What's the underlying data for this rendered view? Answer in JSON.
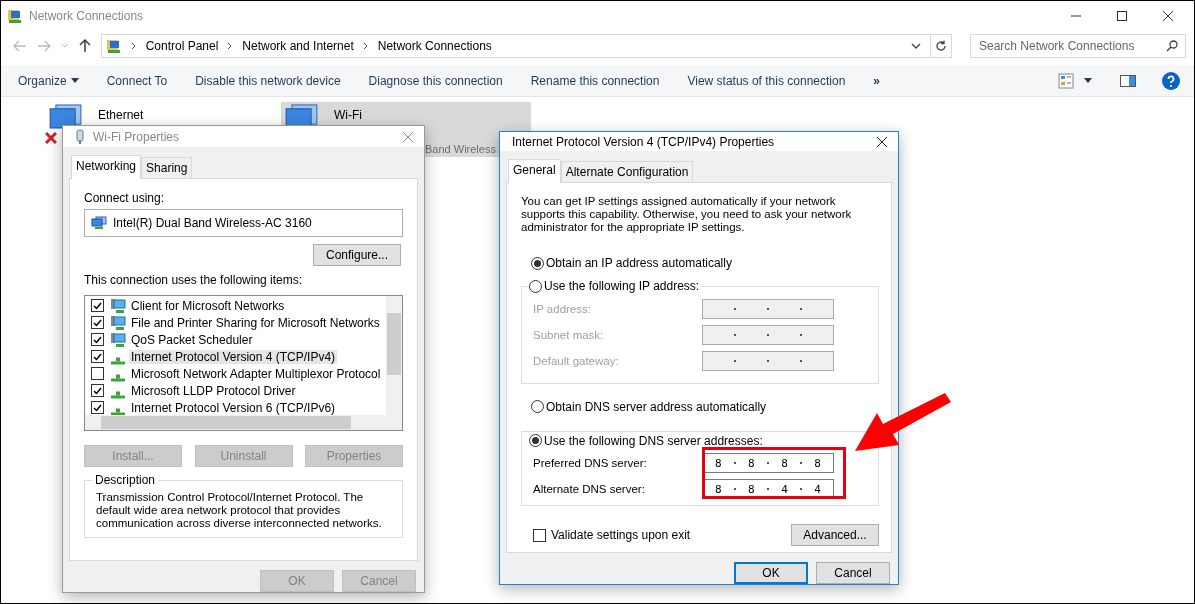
{
  "window": {
    "title": "Network Connections"
  },
  "address_bar": {
    "path": [
      "Control Panel",
      "Network and Internet",
      "Network Connections"
    ]
  },
  "search": {
    "placeholder": "Search Network Connections"
  },
  "toolbar": [
    {
      "label": "Organize",
      "kind": "menu"
    },
    {
      "label": "Connect To",
      "kind": "action"
    },
    {
      "label": "Disable this network device",
      "kind": "action"
    },
    {
      "label": "Diagnose this connection",
      "kind": "action"
    },
    {
      "label": "Rename this connection",
      "kind": "action"
    },
    {
      "label": "View status of this connection",
      "kind": "action"
    },
    {
      "label": "»",
      "kind": "more"
    }
  ],
  "connections": [
    {
      "name": "Ethernet",
      "disconnected": true,
      "selected": false
    },
    {
      "name": "Wi-Fi",
      "disconnected": false,
      "selected": true,
      "detail": "Band Wireless"
    }
  ],
  "wifi_dialog": {
    "title": "Wi-Fi Properties",
    "tabs": [
      {
        "label": "Networking",
        "selected": true
      },
      {
        "label": "Sharing",
        "selected": false
      }
    ],
    "connect_using_label": "Connect using:",
    "adapter": "Intel(R) Dual Band Wireless-AC 3160",
    "configure_button": "Configure...",
    "items_label": "This connection uses the following items:",
    "items": [
      {
        "label": "Client for Microsoft Networks",
        "checked": true,
        "selected": false,
        "kind": "service"
      },
      {
        "label": "File and Printer Sharing for Microsoft Networks",
        "checked": true,
        "selected": false,
        "kind": "service"
      },
      {
        "label": "QoS Packet Scheduler",
        "checked": true,
        "selected": false,
        "kind": "service"
      },
      {
        "label": "Internet Protocol Version 4 (TCP/IPv4)",
        "checked": true,
        "selected": true,
        "kind": "protocol"
      },
      {
        "label": "Microsoft Network Adapter Multiplexor Protocol",
        "checked": false,
        "selected": false,
        "kind": "protocol"
      },
      {
        "label": "Microsoft LLDP Protocol Driver",
        "checked": true,
        "selected": false,
        "kind": "protocol"
      },
      {
        "label": "Internet Protocol Version 6 (TCP/IPv6)",
        "checked": true,
        "selected": false,
        "kind": "protocol"
      }
    ],
    "item_buttons": [
      {
        "label": "Install...",
        "disabled": true
      },
      {
        "label": "Uninstall",
        "disabled": true
      },
      {
        "label": "Properties",
        "disabled": true
      }
    ],
    "description_title": "Description",
    "description": "Transmission Control Protocol/Internet Protocol. The default wide area network protocol that provides communication across diverse interconnected networks.",
    "footer_buttons": [
      {
        "label": "OK",
        "disabled": true
      },
      {
        "label": "Cancel",
        "disabled": true
      }
    ]
  },
  "ipv4_dialog": {
    "title": "Internet Protocol Version 4 (TCP/IPv4) Properties",
    "tabs": [
      {
        "label": "General",
        "selected": true
      },
      {
        "label": "Alternate Configuration",
        "selected": false
      }
    ],
    "intro": "You can get IP settings assigned automatically if your network supports this capability. Otherwise, you need to ask your network administrator for the appropriate IP settings.",
    "ip_options": [
      {
        "label": "Obtain an IP address automatically",
        "selected": true
      },
      {
        "label": "Use the following IP address:",
        "selected": false
      }
    ],
    "ip_fields": [
      {
        "label": "IP address:",
        "disabled": true
      },
      {
        "label": "Subnet mask:",
        "disabled": true
      },
      {
        "label": "Default gateway:",
        "disabled": true
      }
    ],
    "dns_options": [
      {
        "label": "Obtain DNS server address automatically",
        "selected": false
      },
      {
        "label": "Use the following DNS server addresses:",
        "selected": true
      }
    ],
    "dns_fields": [
      {
        "label": "Preferred DNS server:",
        "disabled": false,
        "octets": [
          "8",
          "8",
          "8",
          "8"
        ]
      },
      {
        "label": "Alternate DNS server:",
        "disabled": false,
        "octets": [
          "8",
          "8",
          "4",
          "4"
        ]
      }
    ],
    "validate": {
      "label": "Validate settings upon exit",
      "checked": false
    },
    "advanced_button": "Advanced...",
    "footer_buttons": [
      {
        "label": "OK",
        "default": true
      },
      {
        "label": "Cancel",
        "default": false
      }
    ]
  }
}
